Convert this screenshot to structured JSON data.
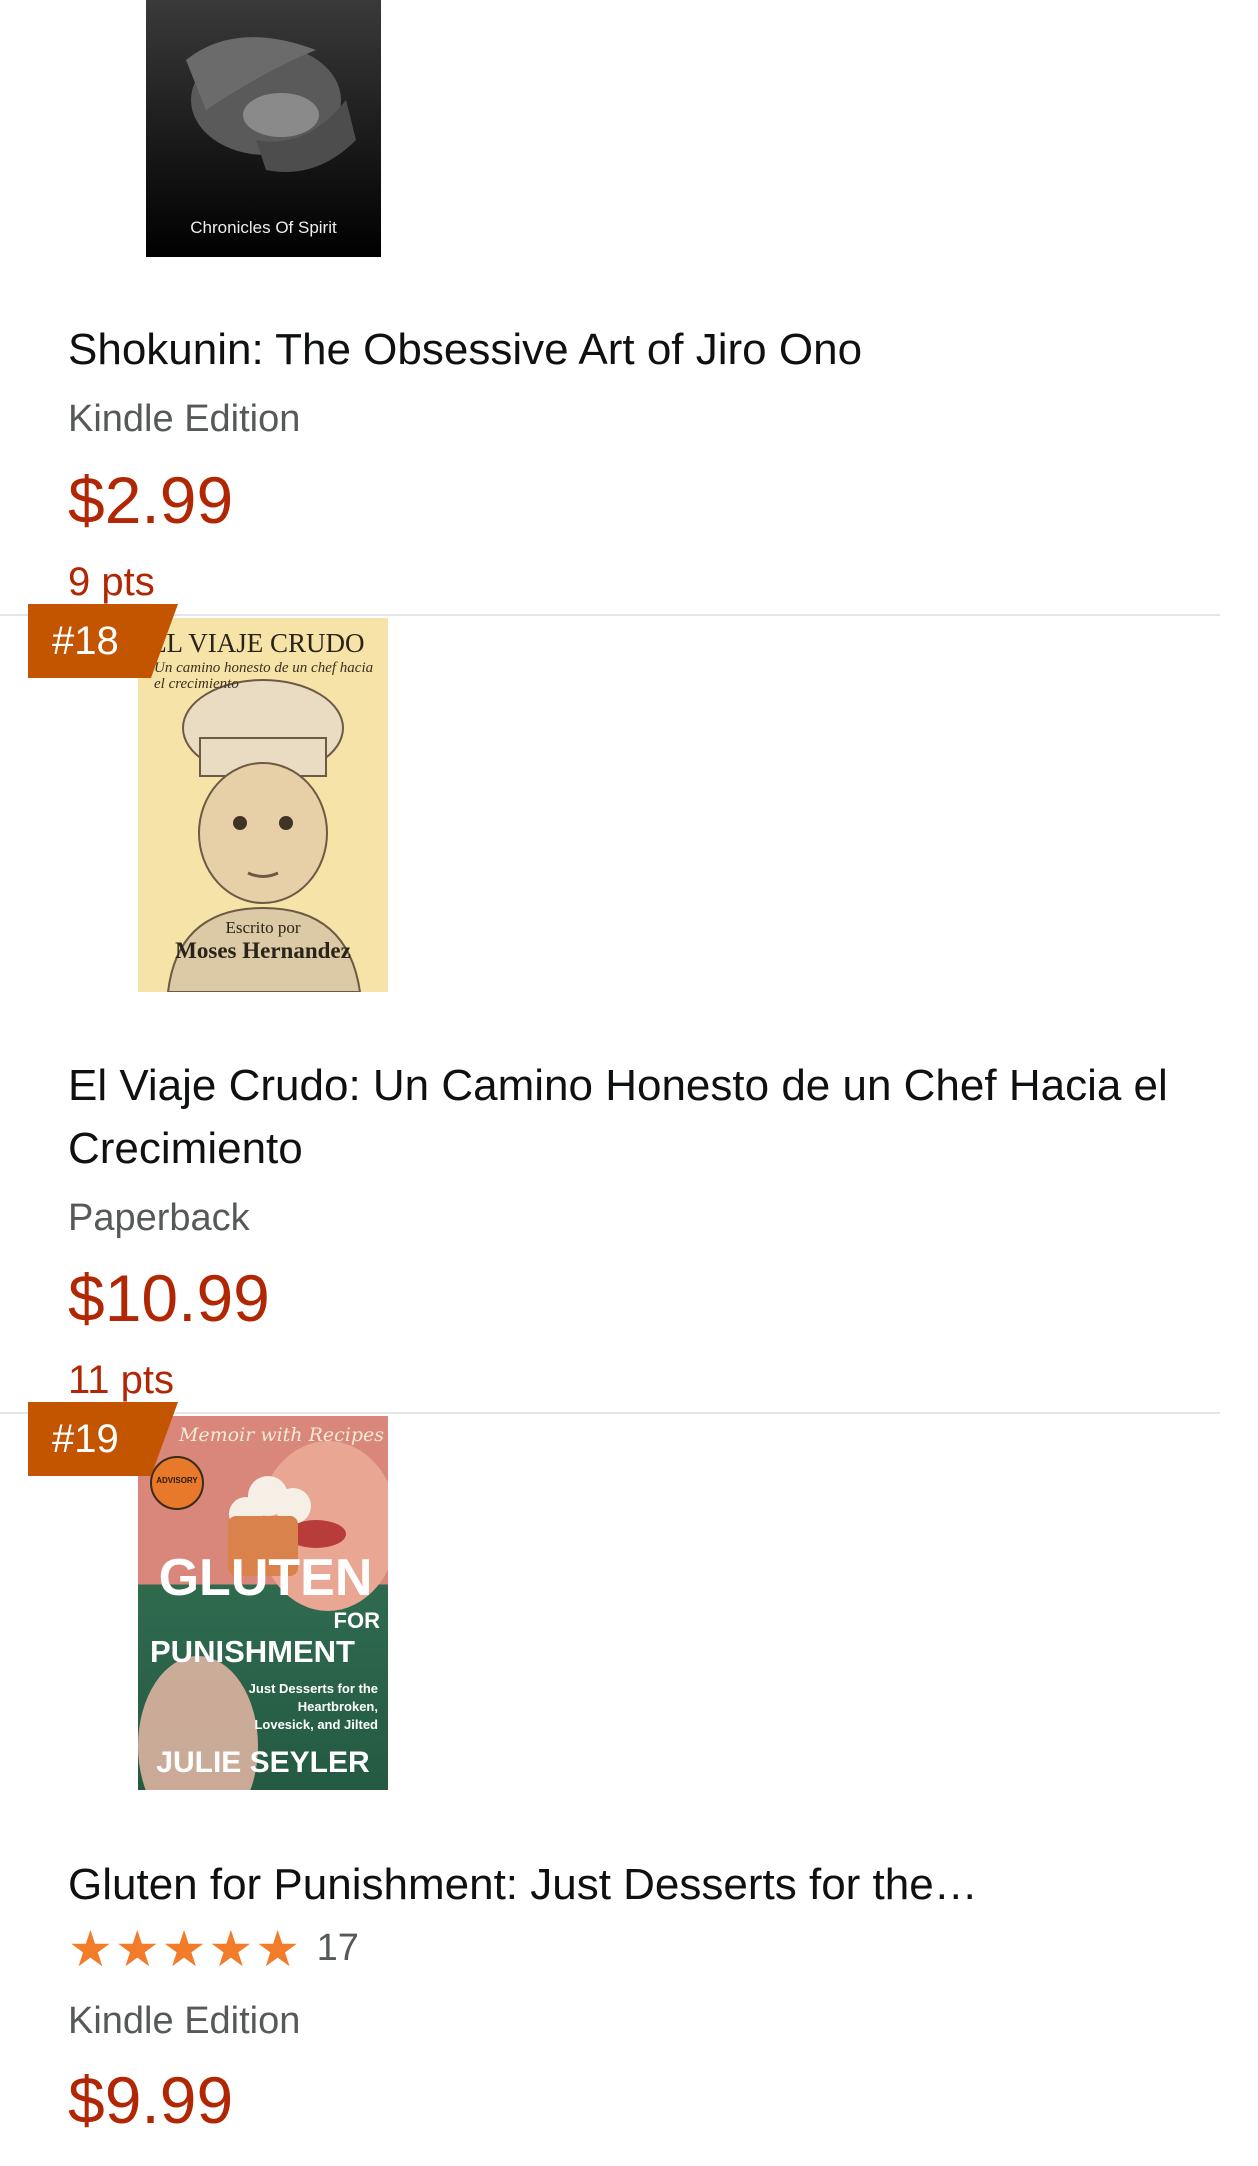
{
  "items": [
    {
      "cover_text": "Chronicles Of Spirit",
      "title": "Shokunin: The Obsessive Art of Jiro Ono",
      "format": "Kindle Edition",
      "price": "$2.99",
      "points": "9 pts"
    },
    {
      "rank": "#18",
      "cover": {
        "title": "EL VIAJE CRUDO",
        "subtitle": "Un camino honesto de un chef hacia el crecimiento",
        "byline": "Escrito por",
        "author": "Moses Hernandez"
      },
      "title": "El Viaje Crudo: Un Camino Honesto de un Chef Hacia el Crecimiento",
      "format": "Paperback",
      "price": "$10.99",
      "points": "11 pts"
    },
    {
      "rank": "#19",
      "cover": {
        "tag": "Memoir with Recipes",
        "advisory": "ADVISORY",
        "title": "GLUTEN",
        "for": "FOR",
        "punishment": "PUNISHMENT",
        "tagline": "Just Desserts for the Heartbroken, Lovesick, and Jilted",
        "author": "JULIE SEYLER"
      },
      "title": "Gluten for Punishment: Just Desserts for the…",
      "rating": 5,
      "rating_count": "17",
      "format": "Kindle Edition",
      "price": "$9.99"
    }
  ],
  "colors": {
    "price": "#b12704",
    "rank_badge": "#c45500",
    "star": "#f27c2a"
  }
}
